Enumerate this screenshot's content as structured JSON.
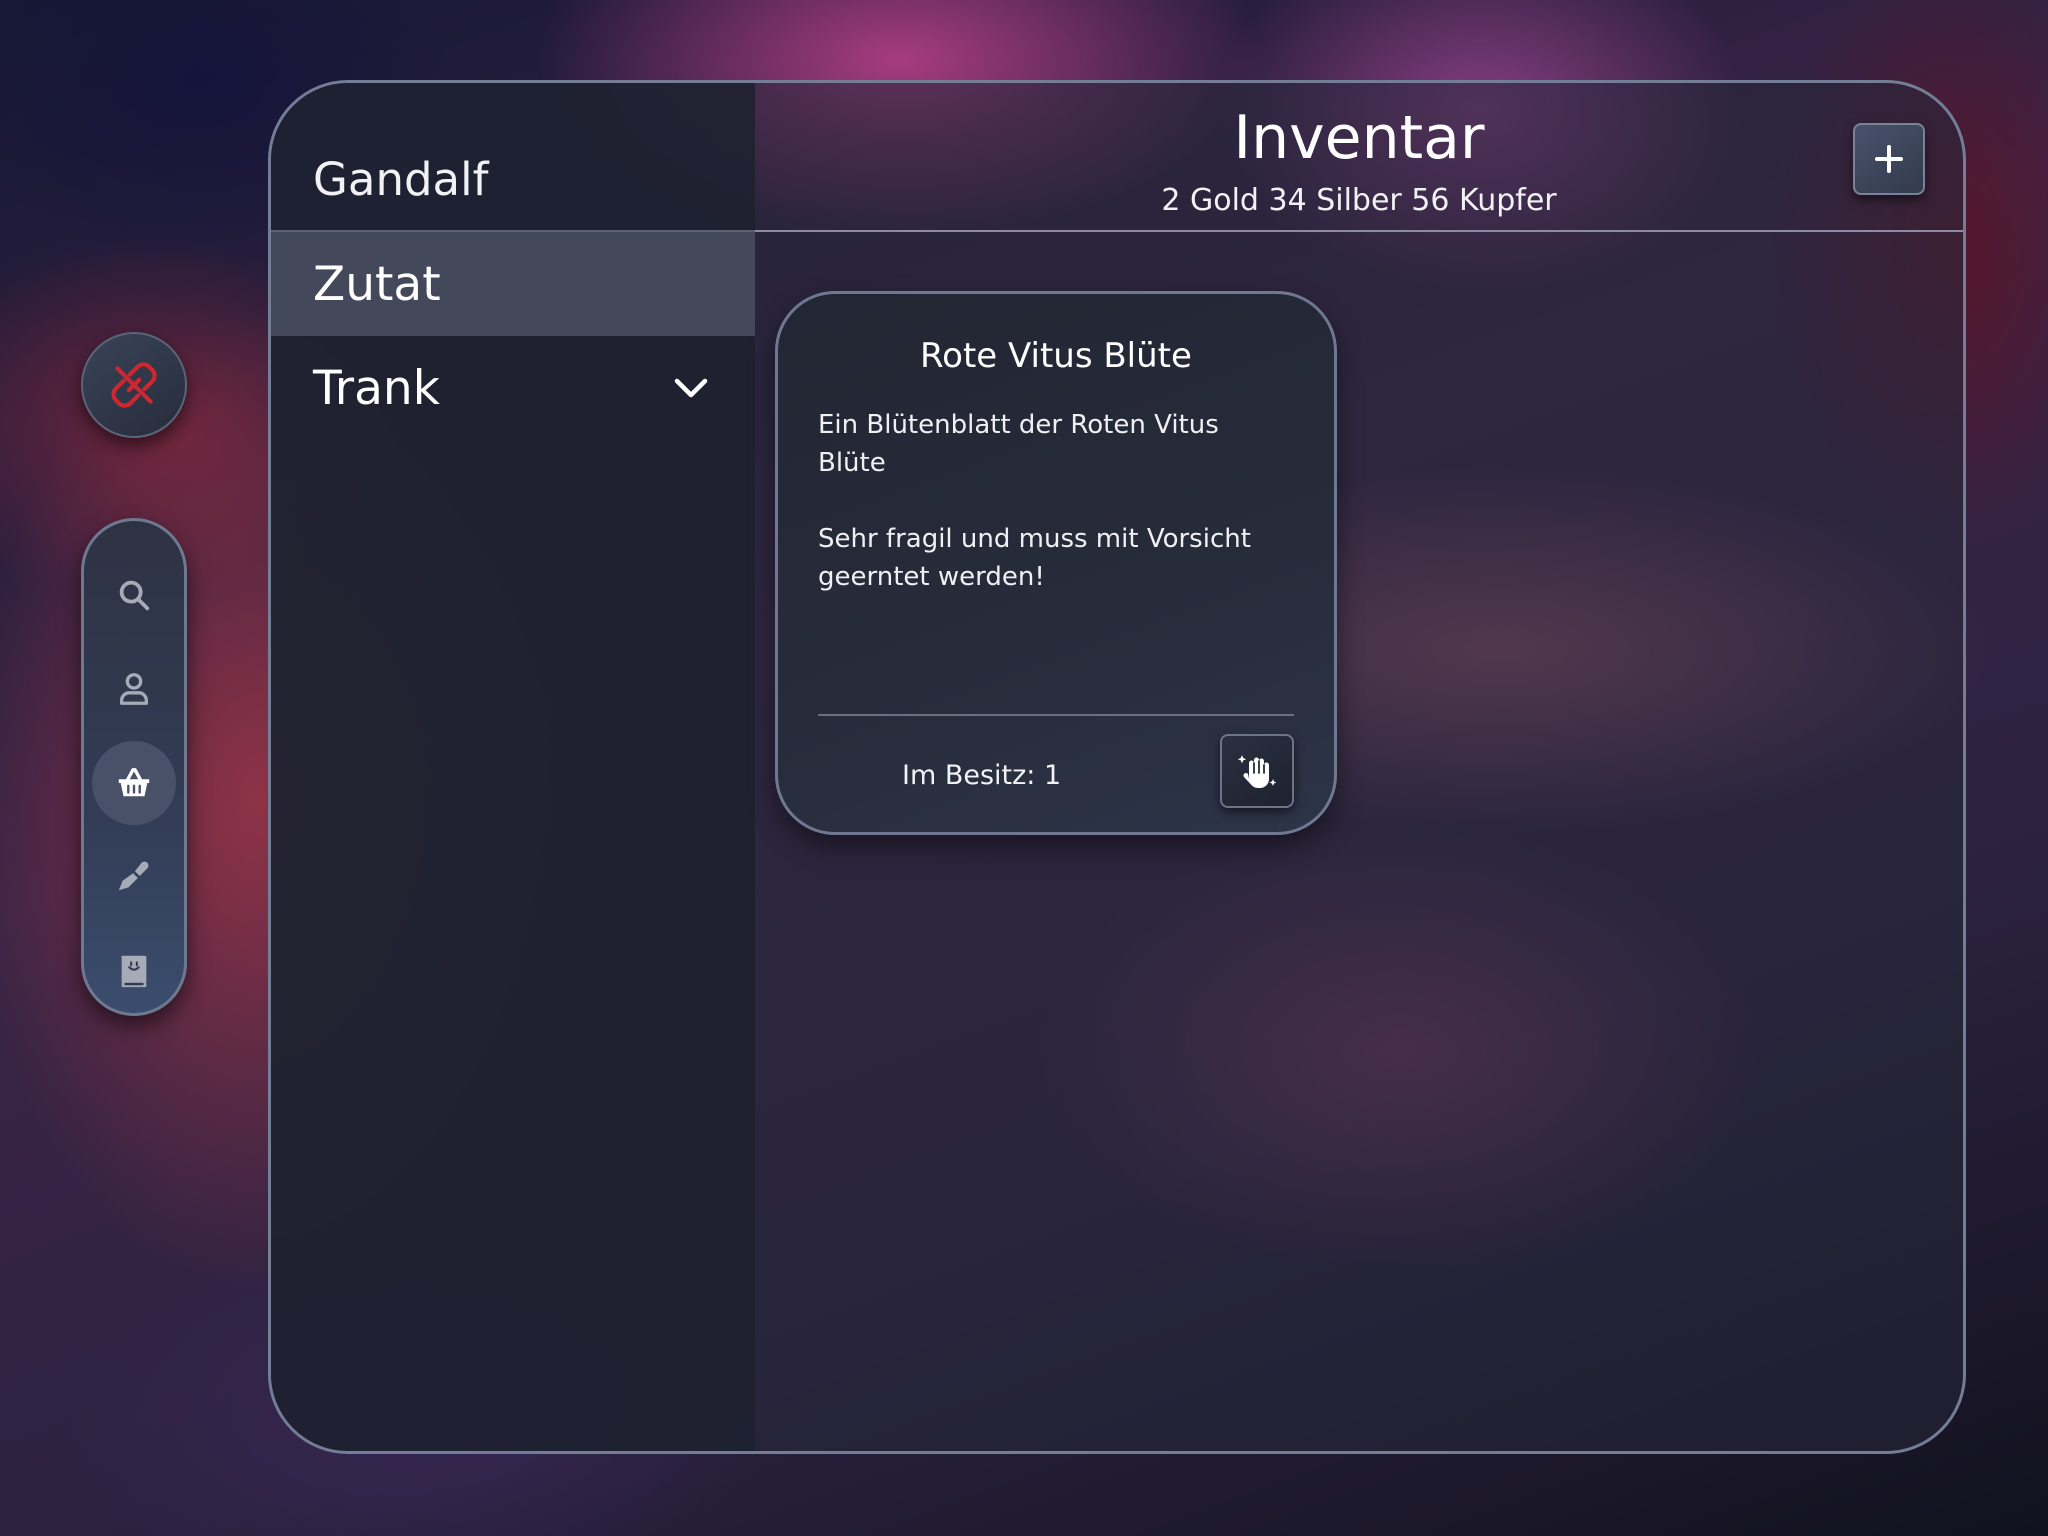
{
  "character": {
    "name": "Gandalf"
  },
  "categories": [
    {
      "label": "Zutat",
      "active": true
    },
    {
      "label": "Trank",
      "active": false
    }
  ],
  "header": {
    "title": "Inventar",
    "money": "2 Gold 34 Silber 56 Kupfer"
  },
  "nav": {
    "icons": [
      "search-icon",
      "person-icon",
      "basket-icon",
      "trowel-icon",
      "book-icon"
    ],
    "active_icon": "basket-icon",
    "sync_icon": "link-off-icon"
  },
  "item": {
    "title": "Rote Vitus Blüte",
    "description_1": "Ein Blütenblatt der Roten Vitus Blüte",
    "description_2": "Sehr fragil und muss mit Vorsicht geerntet werden!",
    "owned": "Im Besitz: 1"
  },
  "colors": {
    "sync_icon": "#d0262f",
    "nav_icon": "#a6abb8",
    "accent_white": "#ffffff"
  }
}
